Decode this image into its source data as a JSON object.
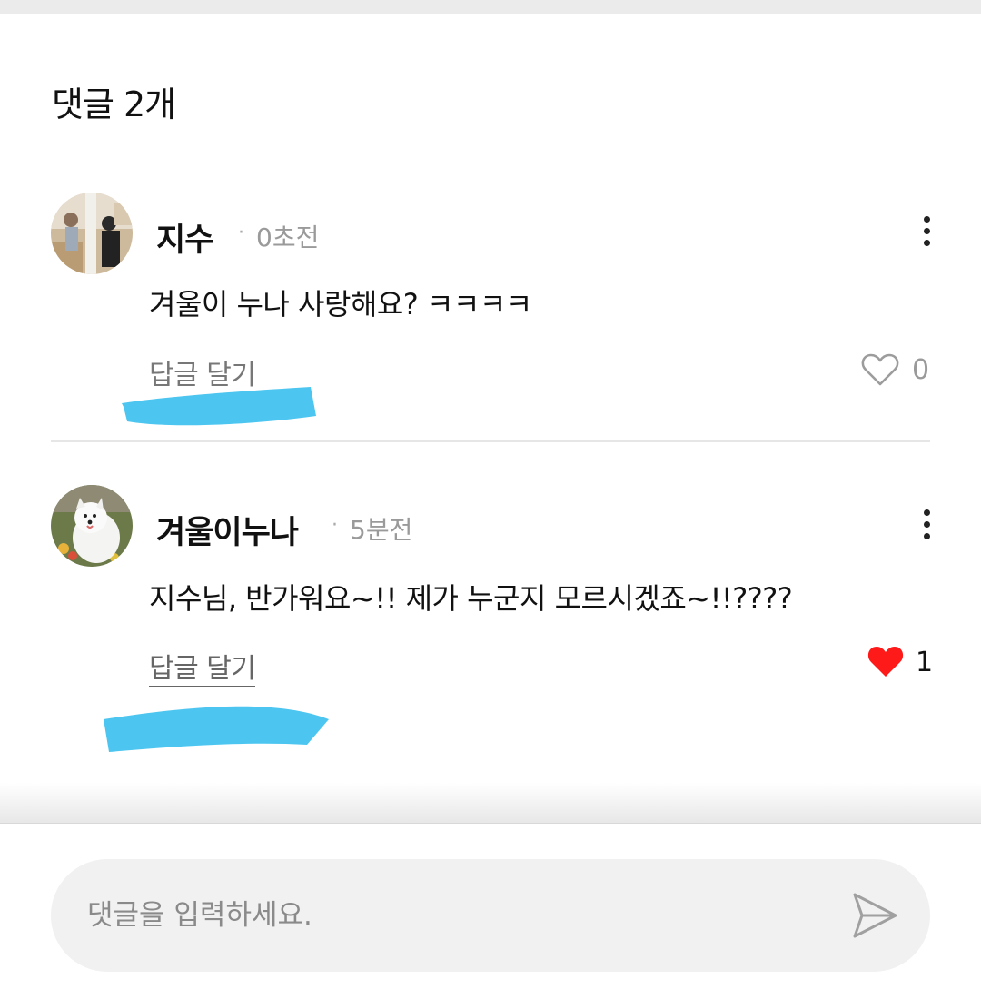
{
  "header": {
    "title": "댓글 2개"
  },
  "comments": [
    {
      "author": "지수",
      "separator": "·",
      "time": "0초전",
      "text": "겨울이 누나 사랑해요? ㅋㅋㅋㅋ",
      "reply_label": "답글 달기",
      "like_count": "0",
      "liked": false,
      "avatar_icon": "profile-photo-people"
    },
    {
      "author": "겨울이누나",
      "separator": "·",
      "time": "5분전",
      "text": "지수님, 반가워요~!! 제가 누군지 모르시겠죠~!!????",
      "reply_label": "답글 달기",
      "like_count": "1",
      "liked": true,
      "avatar_icon": "profile-photo-white-dog"
    }
  ],
  "composer": {
    "placeholder": "댓글을 입력하세요.",
    "send_icon": "send-icon"
  },
  "colors": {
    "like_active": "#ff1a1a",
    "highlight_marker": "#4cc6f0"
  }
}
